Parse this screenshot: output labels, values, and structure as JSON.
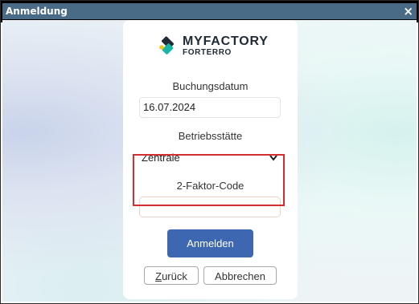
{
  "window": {
    "title": "Anmeldung",
    "close_glyph": "×"
  },
  "logo": {
    "brand": "MYFACTORY",
    "sub": "FORTERRO",
    "icon": "myfactory-logo-icon",
    "colors": {
      "dark": "#1f2a36",
      "teal": "#17b6a7",
      "yellow": "#f5c518"
    }
  },
  "form": {
    "booking_date_label": "Buchungsdatum",
    "booking_date_value": "16.07.2024",
    "site_label": "Betriebsstätte",
    "site_value": "Zentrale",
    "twofa_label": "2-Faktor-Code",
    "twofa_value": ""
  },
  "buttons": {
    "login": "Anmelden",
    "back": "Zurück",
    "cancel": "Abbrechen"
  },
  "colors": {
    "titlebar": "#4a6b86",
    "primary_button": "#3e67b1",
    "highlight_border": "#d32f2f"
  }
}
